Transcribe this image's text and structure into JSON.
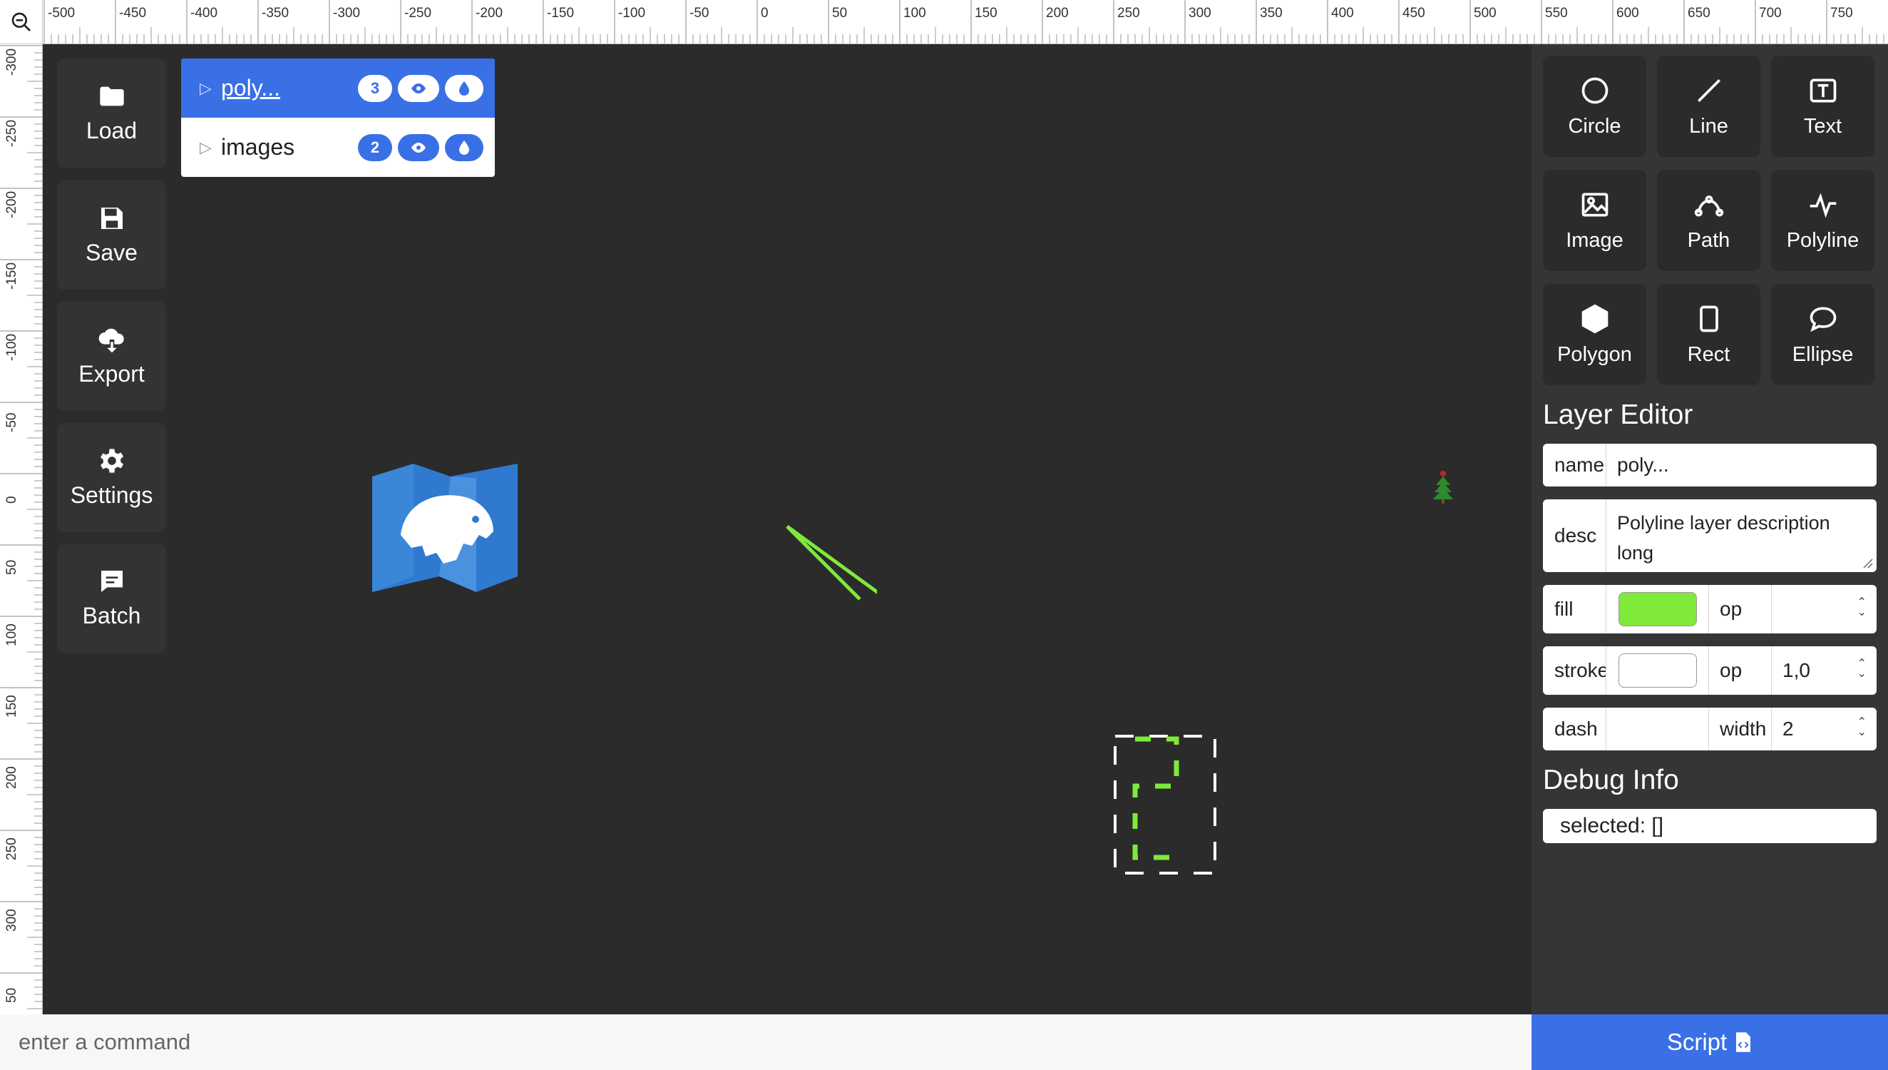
{
  "zoom_icon": "zoom-out-icon",
  "ruler": {
    "top_labels": [
      "-500",
      "-450",
      "-400",
      "-350",
      "-300",
      "-250",
      "-200",
      "-150",
      "-100",
      "-50",
      "0",
      "50",
      "100",
      "150",
      "200",
      "250",
      "300",
      "350",
      "400",
      "450",
      "500",
      "550",
      "600",
      "650",
      "700",
      "750"
    ],
    "left_labels": [
      "-300",
      "-250",
      "-200",
      "-150",
      "-100",
      "-50",
      "0",
      "50",
      "100",
      "150",
      "200",
      "250",
      "300",
      "50"
    ]
  },
  "left_toolbar": {
    "load": {
      "label": "Load",
      "icon": "folder-icon"
    },
    "save": {
      "label": "Save",
      "icon": "floppy-disk-icon"
    },
    "export": {
      "label": "Export",
      "icon": "cloud-download-icon"
    },
    "settings": {
      "label": "Settings",
      "icon": "gear-icon"
    },
    "batch": {
      "label": "Batch",
      "icon": "chat-bubble-icon"
    }
  },
  "layers": [
    {
      "name": "poly...",
      "count": "3",
      "active": true
    },
    {
      "name": "images",
      "count": "2",
      "active": false
    }
  ],
  "tools": [
    {
      "label": "Circle",
      "icon": "circle-icon"
    },
    {
      "label": "Line",
      "icon": "line-icon"
    },
    {
      "label": "Text",
      "icon": "text-icon"
    },
    {
      "label": "Image",
      "icon": "image-icon"
    },
    {
      "label": "Path",
      "icon": "bezier-path-icon"
    },
    {
      "label": "Polyline",
      "icon": "polyline-icon"
    },
    {
      "label": "Polygon",
      "icon": "hexagon-icon"
    },
    {
      "label": "Rect",
      "icon": "rectangle-icon"
    },
    {
      "label": "Ellipse",
      "icon": "speech-bubble-icon"
    }
  ],
  "layer_editor": {
    "title": "Layer Editor",
    "name_label": "name",
    "name_value": "poly...",
    "desc_label": "desc",
    "desc_value": "Polyline layer description long",
    "fill_label": "fill",
    "fill_color": "#7fea3a",
    "fill_op_label": "op",
    "fill_op_value": "",
    "stroke_label": "stroke",
    "stroke_color": "#ffffff",
    "stroke_op_label": "op",
    "stroke_op_value": "1,0",
    "dash_label": "dash",
    "dash_value": "",
    "width_label": "width",
    "width_value": "2"
  },
  "debug": {
    "title": "Debug Info",
    "selected": "selected: []"
  },
  "command": {
    "placeholder": "enter a command"
  },
  "script_button": {
    "label": "Script",
    "icon": "code-file-icon"
  },
  "colors": {
    "accent": "#3a70e6",
    "canvas": "#2b2b2b",
    "green": "#7fea3a"
  }
}
